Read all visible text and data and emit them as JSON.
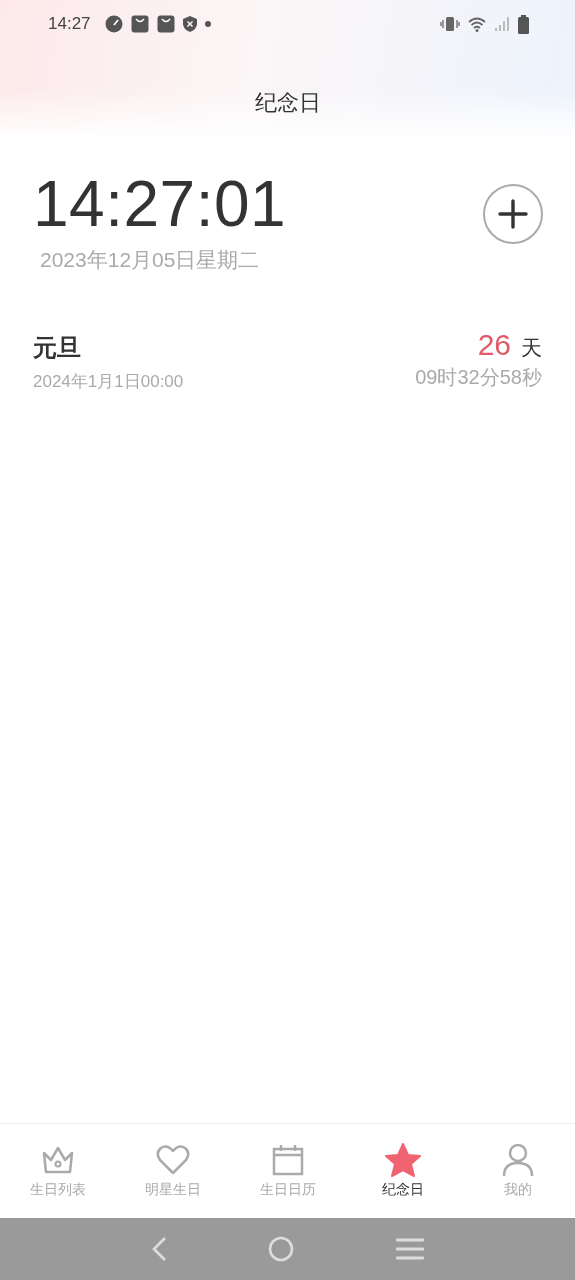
{
  "status_bar": {
    "time": "14:27"
  },
  "header": {
    "title": "纪念日"
  },
  "clock": {
    "time": "14:27:01",
    "date": "2023年12月05日星期二"
  },
  "events": [
    {
      "name": "元旦",
      "date": "2024年1月1日00:00",
      "days": "26",
      "days_unit": "天",
      "remaining": "09时32分58秒"
    }
  ],
  "tabs": [
    {
      "label": "生日列表",
      "kind": "crown",
      "selected": false
    },
    {
      "label": "明星生日",
      "kind": "heart",
      "selected": false
    },
    {
      "label": "生日日历",
      "kind": "calendar",
      "selected": false
    },
    {
      "label": "纪念日",
      "kind": "star",
      "selected": true
    },
    {
      "label": "我的",
      "kind": "person",
      "selected": false
    }
  ]
}
